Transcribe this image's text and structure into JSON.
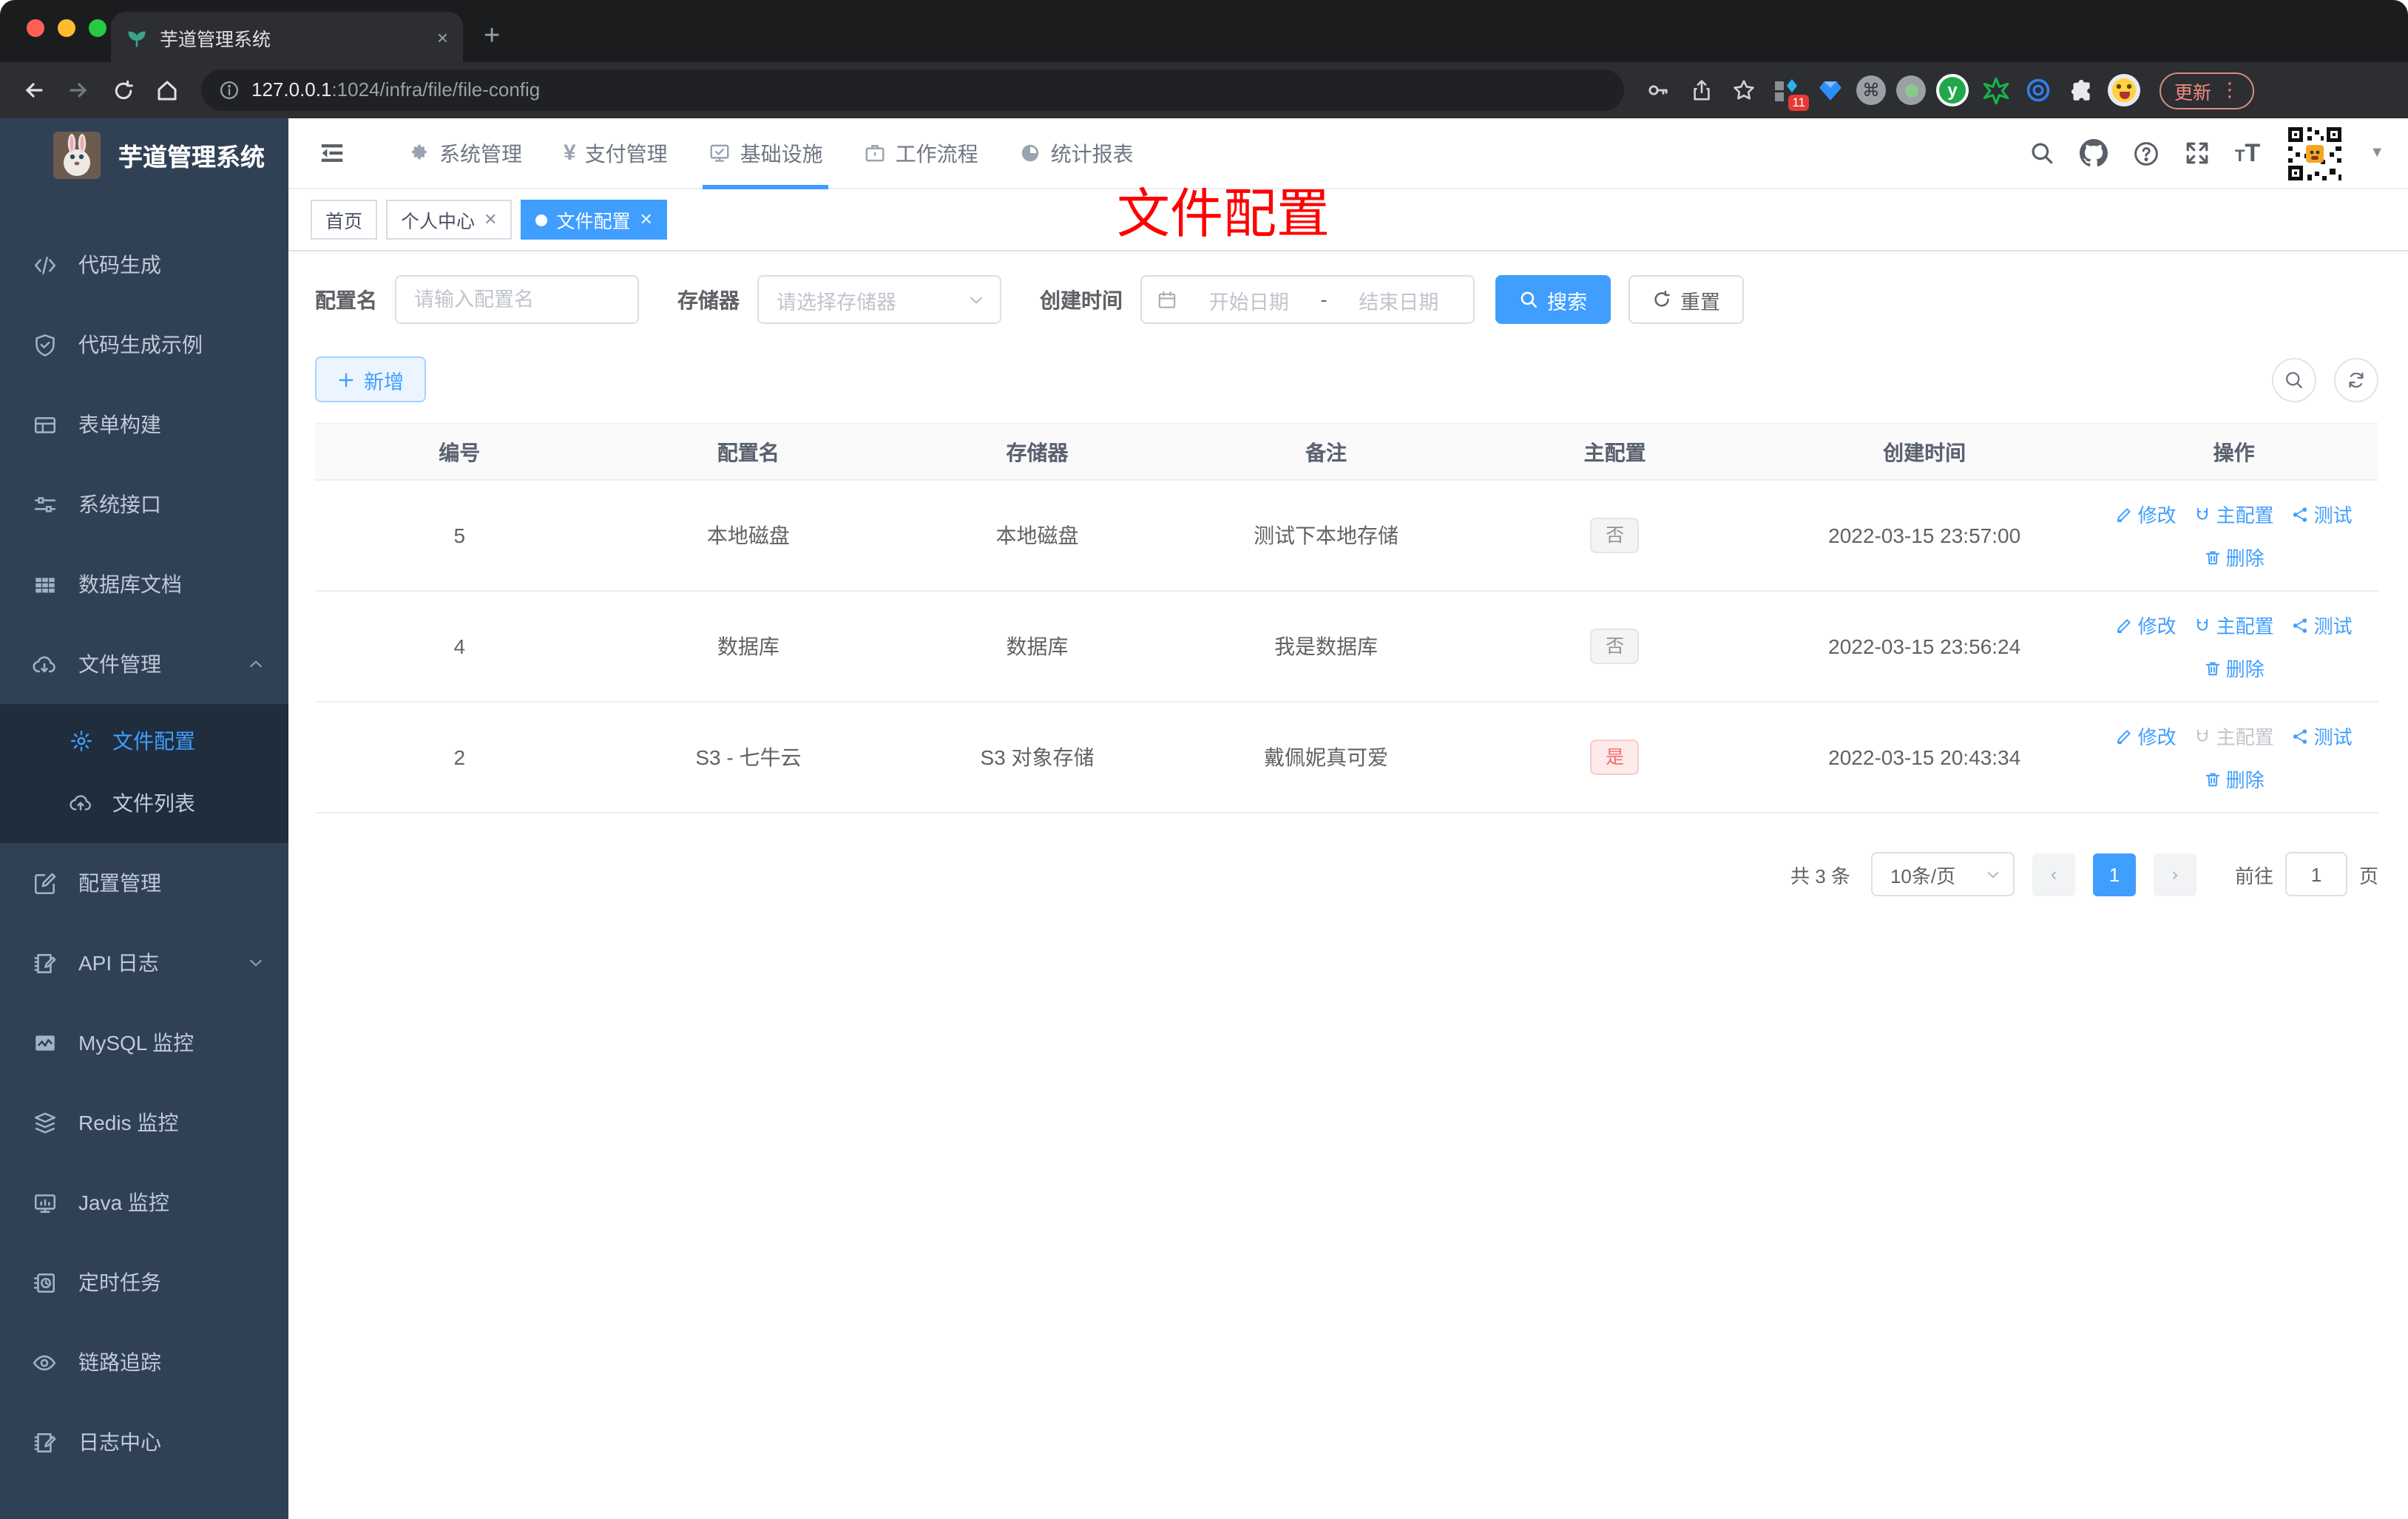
{
  "browser": {
    "tab_title": "芋道管理系统",
    "url_host": "127.0.0.1",
    "url_path": ":1024/infra/file/file-config",
    "extension_badge": "11",
    "ext_y_label": "y",
    "update_label": "更新",
    "menu_dots": "⋮",
    "new_tab": "+",
    "close_tab": "×"
  },
  "sidebar": {
    "title": "芋道管理系统",
    "items": [
      {
        "label": "代码生成"
      },
      {
        "label": "代码生成示例"
      },
      {
        "label": "表单构建"
      },
      {
        "label": "系统接口"
      },
      {
        "label": "数据库文档"
      },
      {
        "label": "文件管理"
      },
      {
        "label": "文件配置"
      },
      {
        "label": "文件列表"
      },
      {
        "label": "配置管理"
      },
      {
        "label": "API 日志"
      },
      {
        "label": "MySQL 监控"
      },
      {
        "label": "Redis 监控"
      },
      {
        "label": "Java 监控"
      },
      {
        "label": "定时任务"
      },
      {
        "label": "链路追踪"
      },
      {
        "label": "日志中心"
      }
    ]
  },
  "topnav": {
    "items": [
      {
        "label": "系统管理"
      },
      {
        "label": "支付管理"
      },
      {
        "label": "基础设施"
      },
      {
        "label": "工作流程"
      },
      {
        "label": "统计报表"
      }
    ],
    "yen": "¥",
    "font_size_icon": "T"
  },
  "tabs": {
    "items": [
      {
        "label": "首页"
      },
      {
        "label": "个人中心"
      },
      {
        "label": "文件配置"
      }
    ]
  },
  "annotation": {
    "label": "文件配置"
  },
  "filters": {
    "name_label": "配置名",
    "name_placeholder": "请输入配置名",
    "storage_label": "存储器",
    "storage_placeholder": "请选择存储器",
    "date_label": "创建时间",
    "date_start": "开始日期",
    "date_sep": "-",
    "date_end": "结束日期",
    "search_label": "搜索",
    "reset_label": "重置"
  },
  "toolbar": {
    "add_label": "新增"
  },
  "table": {
    "headers": [
      "编号",
      "配置名",
      "存储器",
      "备注",
      "主配置",
      "创建时间",
      "操作"
    ],
    "actions": {
      "edit": "修改",
      "master": "主配置",
      "test": "测试",
      "delete": "删除"
    },
    "rows": [
      {
        "id": "5",
        "name": "本地磁盘",
        "storage": "本地磁盘",
        "remark": "测试下本地存储",
        "master": "否",
        "created": "2022-03-15 23:57:00"
      },
      {
        "id": "4",
        "name": "数据库",
        "storage": "数据库",
        "remark": "我是数据库",
        "master": "否",
        "created": "2022-03-15 23:56:24"
      },
      {
        "id": "2",
        "name": "S3 - 七牛云",
        "storage": "S3 对象存储",
        "remark": "戴佩妮真可爱",
        "master": "是",
        "created": "2022-03-15 20:43:34"
      }
    ]
  },
  "pagination": {
    "total": "共 3 条",
    "page_size": "10条/页",
    "prev": "‹",
    "next": "›",
    "page": "1",
    "goto_prefix": "前往",
    "goto_value": "1",
    "goto_suffix": "页"
  },
  "colors": {
    "primary": "#409EFF",
    "danger": "#F56C6C",
    "annotation": "#FF0000",
    "sidebar_bg": "#304156",
    "submenu_bg": "#1F2D3D"
  }
}
